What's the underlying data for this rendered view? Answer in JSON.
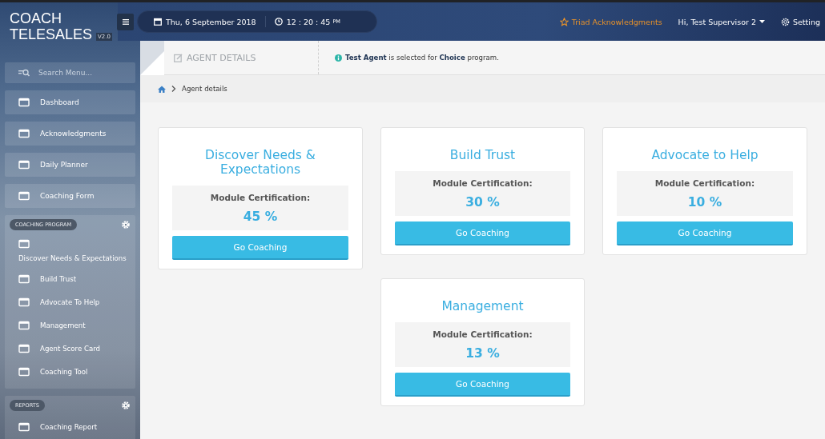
{
  "app": {
    "title_line1": "COACH",
    "title_line2": "TELESALES",
    "version": "V2.0"
  },
  "topbar": {
    "date": "Thu, 6 September 2018",
    "time": "12 : 20 : 45",
    "ampm": "PM",
    "acknowledgments": "Triad Acknowledgments",
    "user": "Hi, Test Supervisor 2",
    "setting": "Setting"
  },
  "sidebar": {
    "search": {
      "placeholder": "Search Menu..."
    },
    "items": [
      {
        "label": "Dashboard"
      },
      {
        "label": "Acknowledgments"
      },
      {
        "label": "Daily Planner"
      },
      {
        "label": "Coaching Form"
      }
    ],
    "groups": [
      {
        "label": "COACHING PROGRAM",
        "items": [
          {
            "label": "Discover Needs & Expectations"
          },
          {
            "label": "Build Trust"
          },
          {
            "label": "Advocate To Help"
          },
          {
            "label": "Management"
          },
          {
            "label": "Agent Score Card"
          },
          {
            "label": "Coaching Tool"
          }
        ]
      },
      {
        "label": "REPORTS",
        "items": [
          {
            "label": "Coaching Report"
          }
        ]
      }
    ]
  },
  "page_header": {
    "title": "AGENT DETAILS",
    "notice": "**Test Agent**  is selected for **Choice**  program."
  },
  "breadcrumb": [
    "Agent details"
  ],
  "modules": [
    {
      "title": "Discover Needs & Expectations",
      "label": "Module Certification:",
      "value": "45 %",
      "button": "Go Coaching"
    },
    {
      "title": "Build Trust",
      "label": "Module Certification:",
      "value": "30 %",
      "button": "Go Coaching"
    },
    {
      "title": "Advocate to Help",
      "label": "Module Certification:",
      "value": "10 %",
      "button": "Go Coaching"
    },
    {
      "title": "Management",
      "label": "Module Certification:",
      "value": "13 %",
      "button": "Go Coaching"
    }
  ]
}
